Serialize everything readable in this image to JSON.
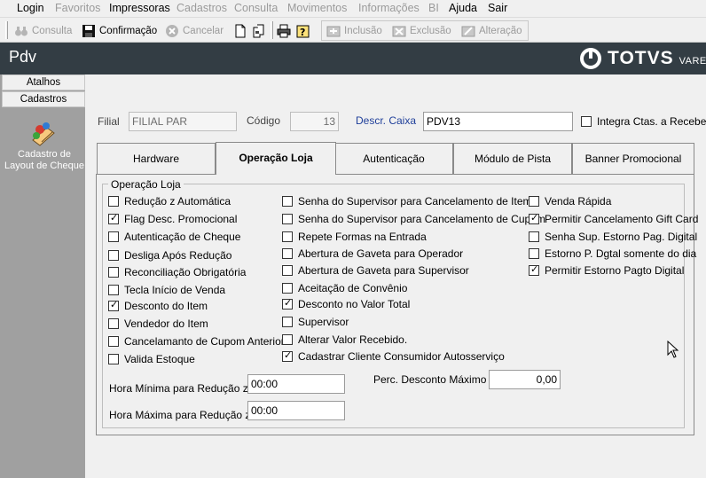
{
  "menu": [
    {
      "label": "Login",
      "u": "L",
      "rest": "ogin",
      "disabled": false
    },
    {
      "label": "Favoritos",
      "disabled": true
    },
    {
      "label": "Impressoras",
      "u": "I",
      "rest": "mpressoras",
      "disabled": false
    },
    {
      "label": "Cadastros",
      "disabled": true
    },
    {
      "label": "Consulta",
      "disabled": true
    },
    {
      "label": "Movimentos",
      "disabled": true
    },
    {
      "label": "Informações",
      "disabled": true
    },
    {
      "label": "BI",
      "disabled": true
    },
    {
      "label": "Ajuda",
      "u": "A",
      "rest": "juda",
      "disabled": false
    },
    {
      "label": "Sair",
      "u": "S",
      "rest": "air",
      "disabled": false
    }
  ],
  "toolbar": {
    "consulta": "Consulta",
    "confirmacao": "Confirmação",
    "cancelar": "Cancelar",
    "inclusao": "Inclusão",
    "exclusao": "Exclusão",
    "alteracao": "Alteração"
  },
  "header": {
    "title": "Pdv",
    "logo_brand": "TOTVS",
    "logo_sub": "VAREJO"
  },
  "sidebar": {
    "atalhos": "Atalhos",
    "cadastros": "Cadastros",
    "item_label": "Cadastro de Layout de Cheque"
  },
  "fields": {
    "filial_label": "Filial",
    "filial_value": "FILIAL PAR",
    "codigo_label": "Código",
    "codigo_value": "13",
    "descr_label": "Descr. Caixa",
    "descr_value": "PDV13",
    "integra_label": "Integra Ctas. a Receber",
    "integra_checked": false
  },
  "tabs": [
    "Hardware",
    "Operação Loja",
    "Autenticação",
    "Módulo de Pista",
    "Banner Promocional"
  ],
  "active_tab": "Operação Loja",
  "group_title": "Operação Loja",
  "col1": [
    {
      "label": "Redução z Automática",
      "checked": false
    },
    {
      "label": "Flag Desc. Promocional",
      "checked": true
    },
    {
      "label": "Autenticação de Cheque",
      "checked": false
    },
    {
      "label": "Desliga Após Redução",
      "checked": false
    },
    {
      "label": "Reconciliação Obrigatória",
      "checked": false
    },
    {
      "label": "Tecla Início de Venda",
      "checked": false
    },
    {
      "label": "Desconto do Item",
      "checked": true
    },
    {
      "label": "Vendedor do Item",
      "checked": false
    },
    {
      "label": "Cancelamanto de Cupom Anterior",
      "checked": false
    },
    {
      "label": "Valida Estoque",
      "checked": false
    }
  ],
  "col2": [
    {
      "label": "Senha do Supervisor para Cancelamento de Item",
      "checked": false
    },
    {
      "label": "Senha do Supervisor para Cancelamento de Cupom",
      "checked": false
    },
    {
      "label": "Repete Formas na Entrada",
      "checked": false
    },
    {
      "label": "Abertura de Gaveta para Operador",
      "checked": false
    },
    {
      "label": "Abertura de Gaveta para  Supervisor",
      "checked": false
    },
    {
      "label": "Aceitação de Convênio",
      "checked": false
    },
    {
      "label": "Desconto no Valor Total",
      "checked": true
    },
    {
      "label": "Supervisor",
      "checked": false
    },
    {
      "label": "Alterar Valor Recebido.",
      "checked": false
    },
    {
      "label": "Cadastrar Cliente Consumidor Autosserviço",
      "checked": true
    }
  ],
  "col3": [
    {
      "label": "Venda Rápida",
      "checked": false
    },
    {
      "label": "Permitir Cancelamento Gift Card",
      "checked": true
    },
    {
      "label": "Senha Sup. Estorno Pag. Digital",
      "checked": false
    },
    {
      "label": "Estorno P. Dgtal somente do dia",
      "checked": false
    },
    {
      "label": "Permitir Estorno Pagto Digital",
      "checked": true
    }
  ],
  "bottom": {
    "hora_min_label": "Hora Mínima para Redução z",
    "hora_min_value": "00:00",
    "hora_max_label": "Hora Máxima para Redução z",
    "hora_max_value": "00:00",
    "perc_label": "Perc. Desconto Máximo",
    "perc_value": "0,00"
  }
}
